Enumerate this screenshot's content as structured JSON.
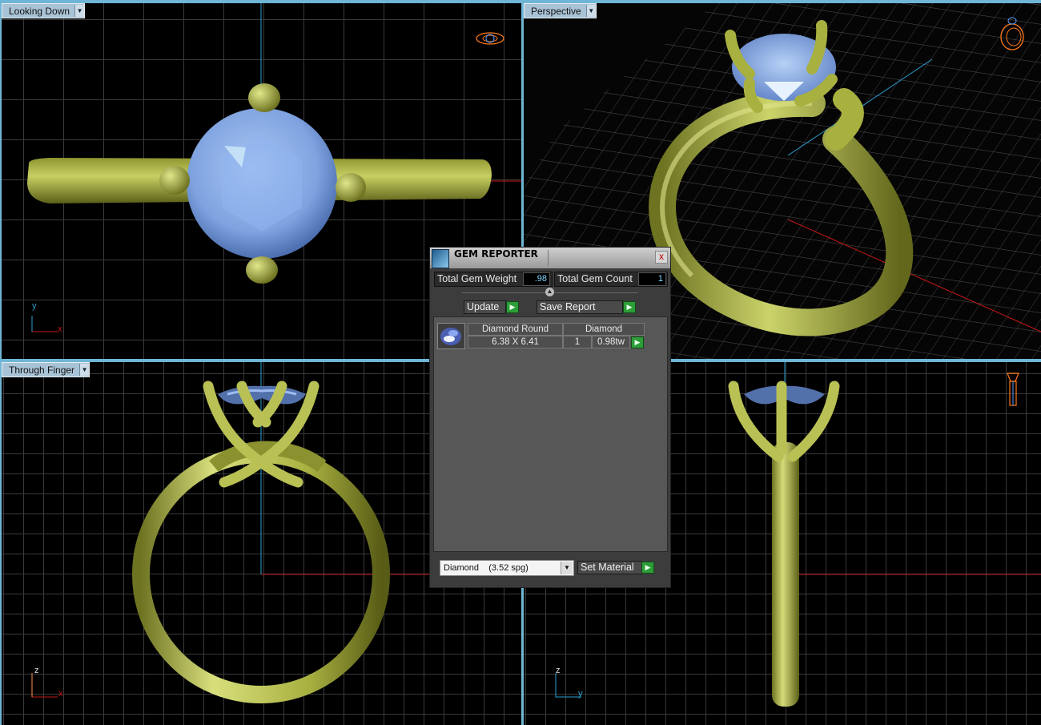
{
  "viewports": {
    "top": {
      "label": "Looking Down",
      "axis_a": "y",
      "axis_b": "x"
    },
    "perspective": {
      "label": "Perspective"
    },
    "front": {
      "label": "Through Finger",
      "axis_a": "z",
      "axis_b": "x"
    },
    "side": {
      "label": "",
      "axis_a": "z",
      "axis_b": "y"
    }
  },
  "gem_reporter": {
    "title": "GEM REPORTER",
    "close": "x",
    "total_weight_label": "Total Gem Weight",
    "total_weight_value": ".98",
    "total_count_label": "Total Gem Count",
    "total_count_value": "1",
    "update_label": "Update",
    "save_report_label": "Save Report",
    "columns": [
      "Diamond Round",
      "Diamond"
    ],
    "gem_row": {
      "size": "6.38 X 6.41",
      "count": "1",
      "weight": "0.98tw"
    },
    "material_selected": "Diamond    (3.52 spg)",
    "set_material_label": "Set Material"
  },
  "colors": {
    "metal": "#a8b040",
    "gem": "#7fa3e0",
    "grid": "#3a3a3a",
    "axis_blue": "#2aa0d0",
    "axis_red": "#c81818",
    "accent_green": "#2c9d38"
  }
}
